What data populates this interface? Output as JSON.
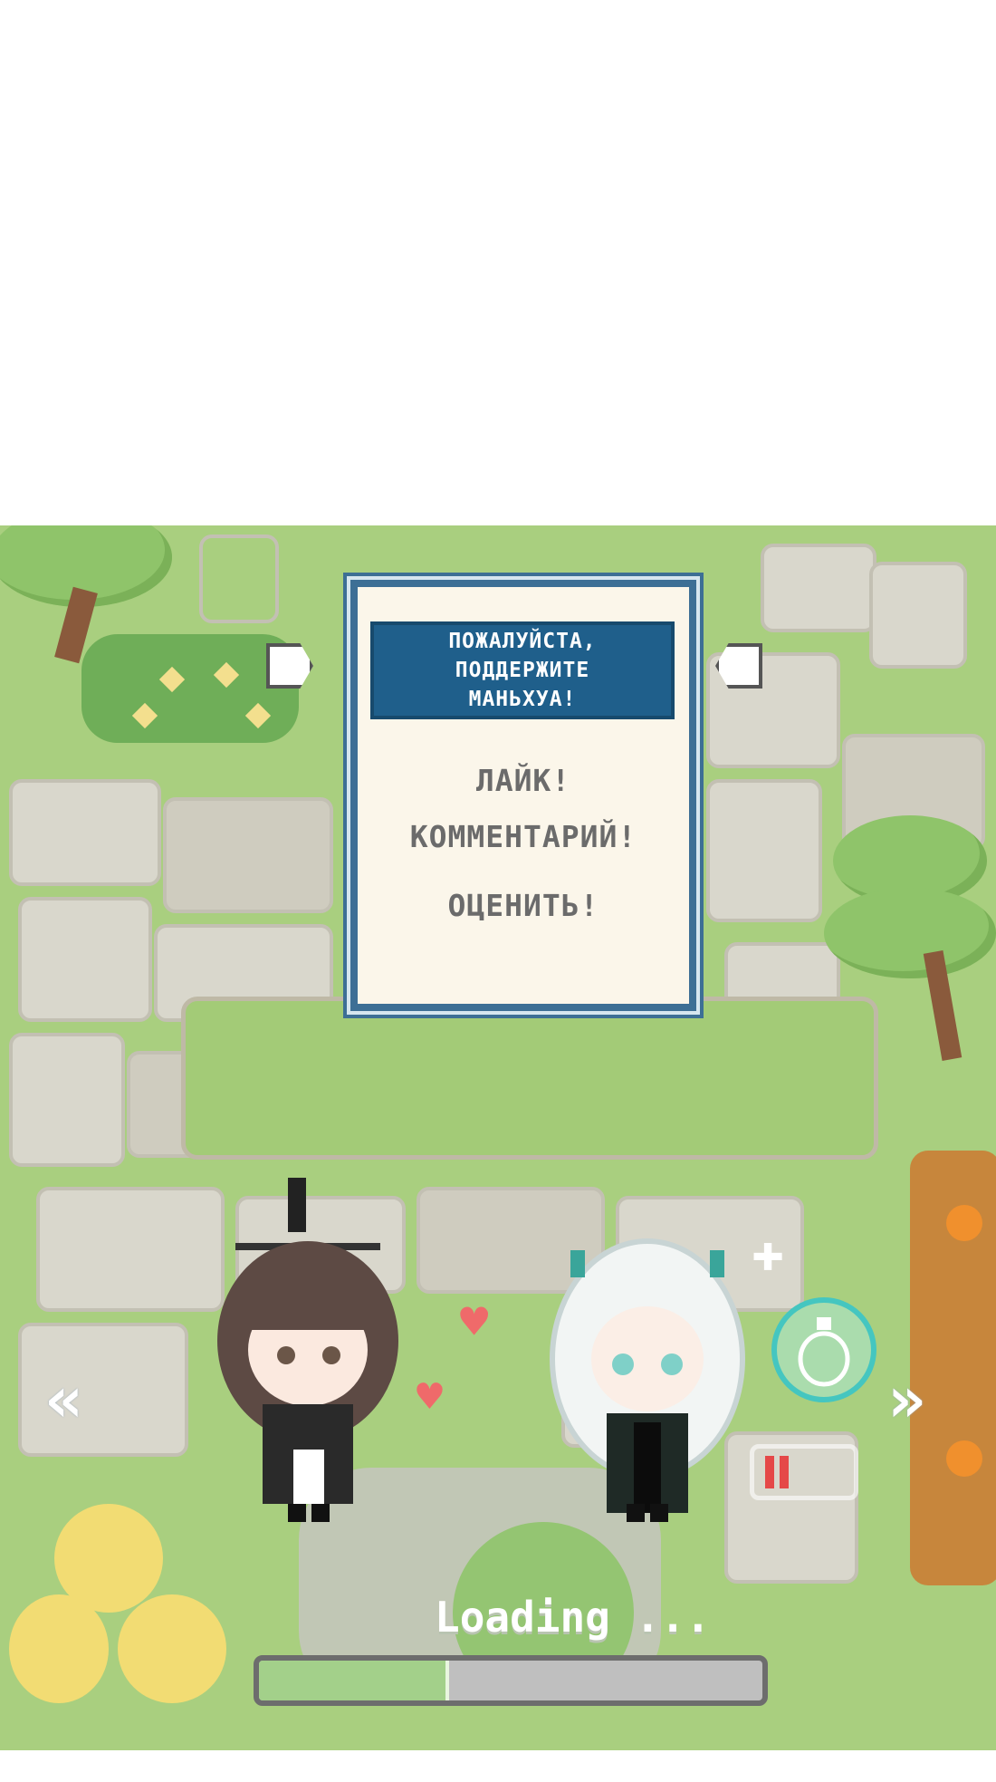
{
  "dialog": {
    "header_line1": "ПОЖАЛУЙСТА,",
    "header_line2": "ПОДДЕРЖИТЕ",
    "header_line3": "МАНЬХУА!",
    "action_like": "ЛАЙК!",
    "action_comment": "КОММЕНТАРИЙ!",
    "action_rate": "ОЦЕНИТЬ!"
  },
  "loading": {
    "label": "Loading ...",
    "progress": 0.37
  },
  "navigation": {
    "prev_label": "«",
    "next_label": "»"
  },
  "characters": [
    {
      "name": "dark-haired-character",
      "icon": "chibi-dark-hair"
    },
    {
      "name": "white-haired-character",
      "icon": "chibi-white-hair"
    }
  ],
  "icons": {
    "heart": "heart-icon",
    "potion_bubble": "potion-bottle-icon",
    "battery": "battery-icon"
  },
  "colors": {
    "dialog_header": "#1f5f8b",
    "dialog_border": "#3d6f95",
    "grass": "#a9cf7f",
    "stone": "#d9d7cc",
    "heart": "#ef6a6a",
    "progress_fill": "#a3d08a"
  }
}
